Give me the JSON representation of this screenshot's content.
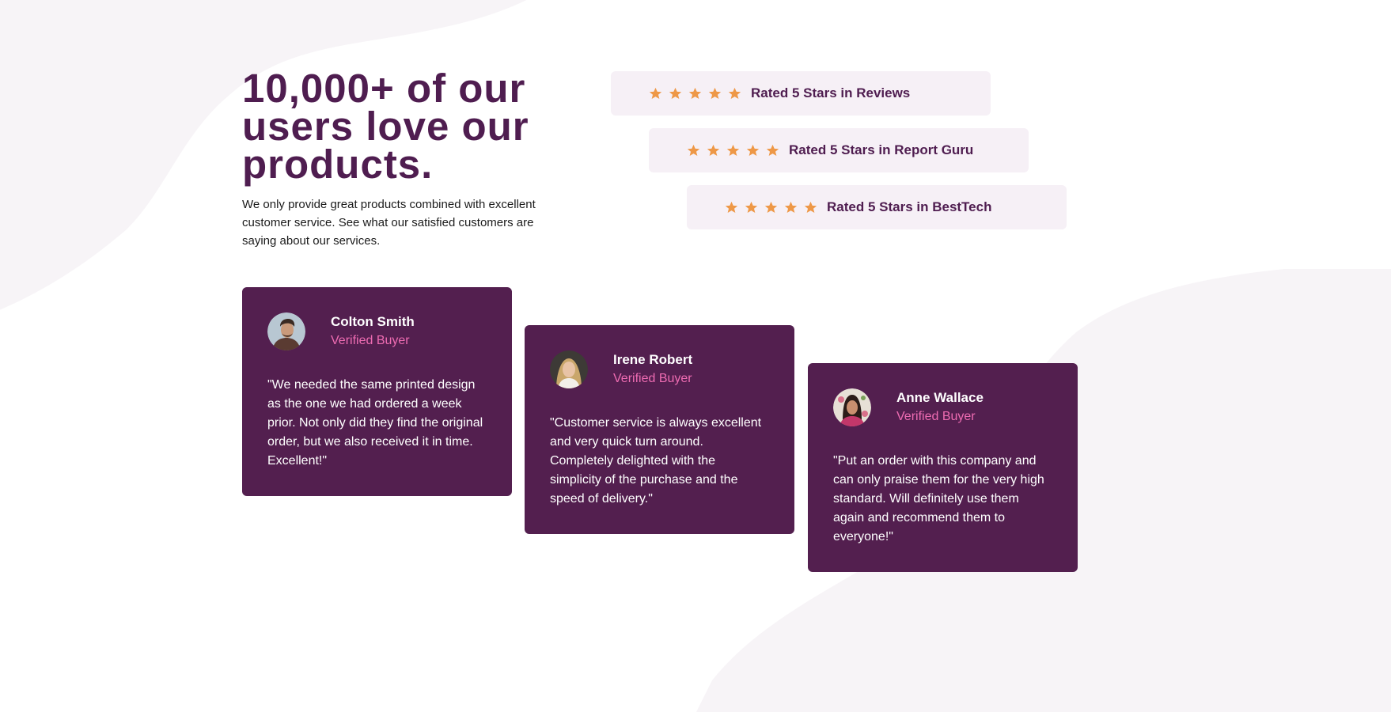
{
  "colors": {
    "brand_dark": "#4f1d50",
    "card_bg": "#531f4f",
    "rating_bg": "#f6f0f6",
    "star": "#ee9847",
    "accent_pink": "#ee6cb2"
  },
  "hero": {
    "headline": "10,000+ of our users love our products.",
    "description": "We only provide great products combined with excellent customer service. See what our satisfied customers are saying about our services."
  },
  "ratings": [
    {
      "stars": 5,
      "label": "Rated 5 Stars in Reviews"
    },
    {
      "stars": 5,
      "label": "Rated 5 Stars in Report Guru"
    },
    {
      "stars": 5,
      "label": "Rated 5 Stars in BestTech"
    }
  ],
  "testimonials": [
    {
      "name": "Colton Smith",
      "role": "Verified Buyer",
      "quote": "\"We needed the same printed design as the one we had ordered a week prior. Not only did they find the original order, but we also received it in time. Excellent!\""
    },
    {
      "name": "Irene Robert",
      "role": "Verified Buyer",
      "quote": "\"Customer service is always excellent and very quick turn around. Completely delighted with the simplicity of the purchase and the speed of delivery.\""
    },
    {
      "name": "Anne Wallace",
      "role": "Verified Buyer",
      "quote": "\"Put an order with this company and can only praise them for the very high standard. Will definitely use them again and recommend them to everyone!\""
    }
  ]
}
